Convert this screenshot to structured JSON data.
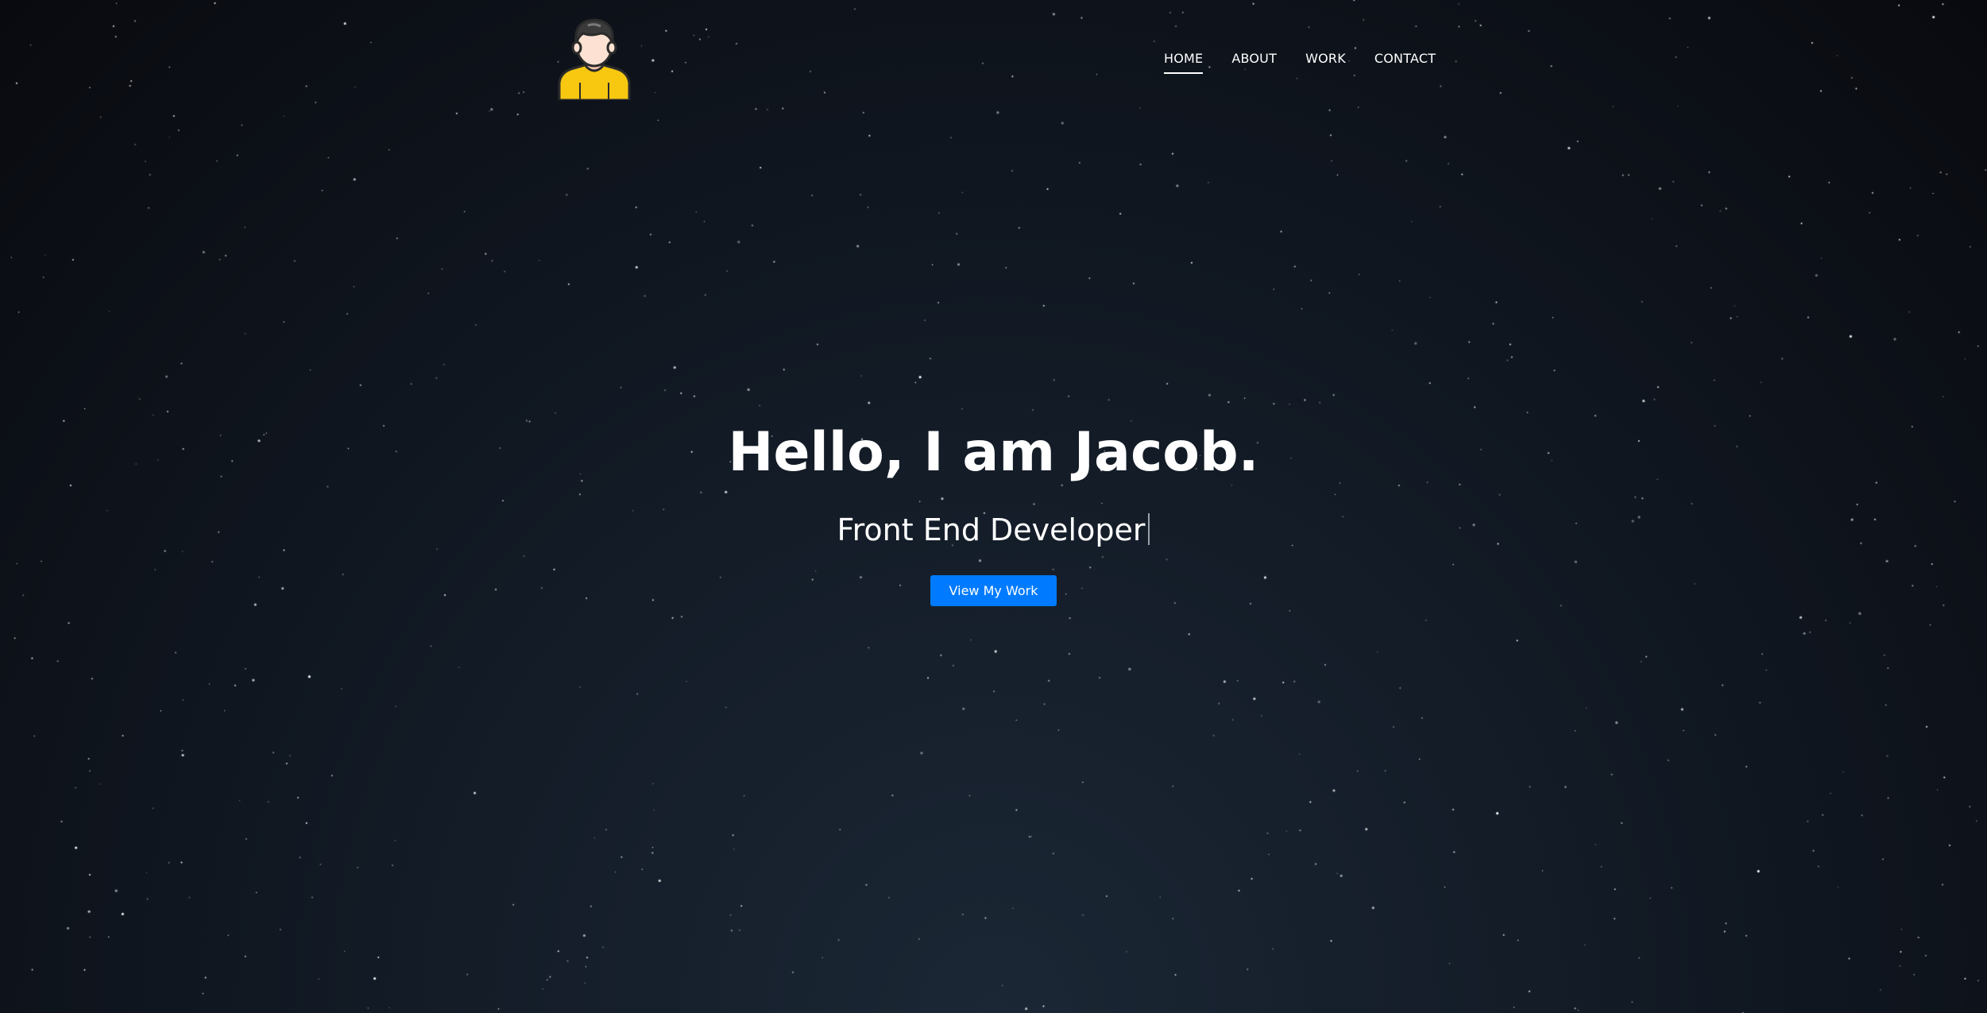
{
  "nav": {
    "logo": "avatar-logo",
    "links": [
      {
        "label": "HOME",
        "active": true
      },
      {
        "label": "ABOUT",
        "active": false
      },
      {
        "label": "WORK",
        "active": false
      },
      {
        "label": "CONTACT",
        "active": false
      }
    ]
  },
  "hero": {
    "title": "Hello, I am Jacob.",
    "subtitle": "Front End Developer",
    "cta_label": "View My Work"
  },
  "colors": {
    "background_top": "#090a0f",
    "background_bottom": "#1b2735",
    "accent": "#007bff",
    "avatar_shirt": "#f8c811",
    "avatar_hair": "#3a3a3a",
    "avatar_skin": "#fde2d3"
  }
}
